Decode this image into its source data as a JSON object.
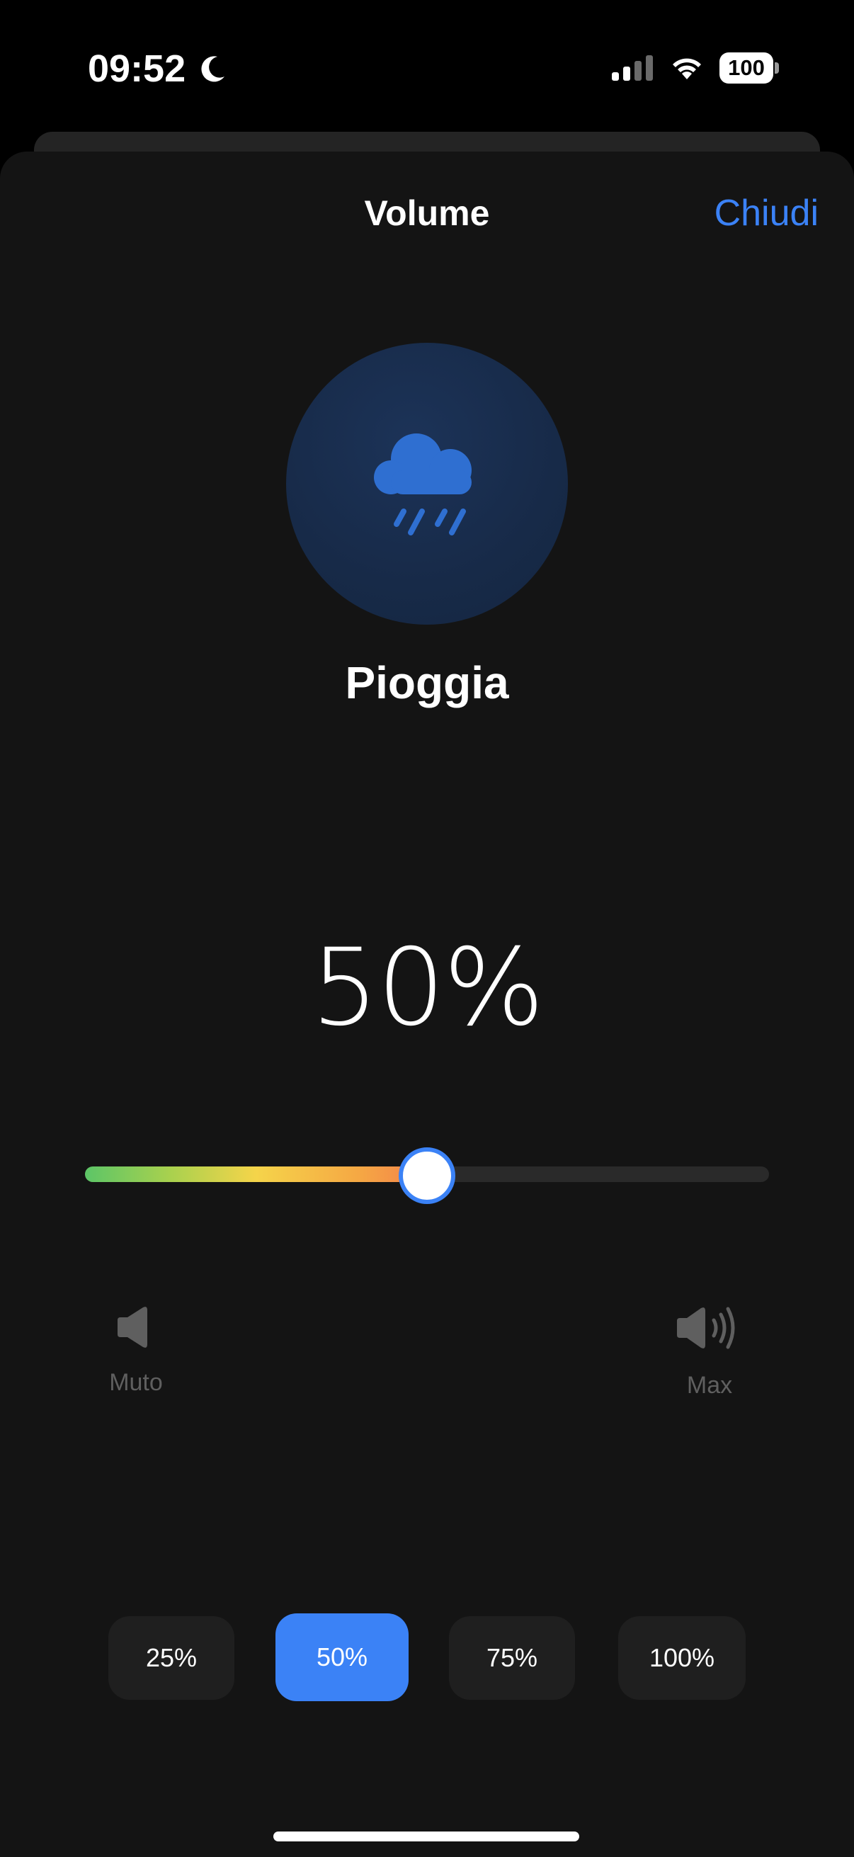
{
  "status_bar": {
    "time": "09:52",
    "battery": "100",
    "icons": [
      "moon-icon",
      "signal-icon",
      "wifi-icon",
      "battery-icon"
    ]
  },
  "sheet": {
    "title": "Volume",
    "close_label": "Chiudi"
  },
  "sound": {
    "name": "Pioggia",
    "icon": "rain-cloud-icon"
  },
  "volume": {
    "display": "50%",
    "level": 0.5
  },
  "labels": {
    "mute": "Muto",
    "max": "Max"
  },
  "presets": [
    {
      "label": "25%",
      "selected": false
    },
    {
      "label": "50%",
      "selected": true
    },
    {
      "label": "75%",
      "selected": false
    },
    {
      "label": "100%",
      "selected": false
    }
  ],
  "colors": {
    "accent": "#3b82f6",
    "background": "#141414",
    "circle": "#172a48",
    "muted_text": "#5f5f5f",
    "gradient": [
      "#5cc567",
      "#f5d44a",
      "#f4804a"
    ]
  }
}
